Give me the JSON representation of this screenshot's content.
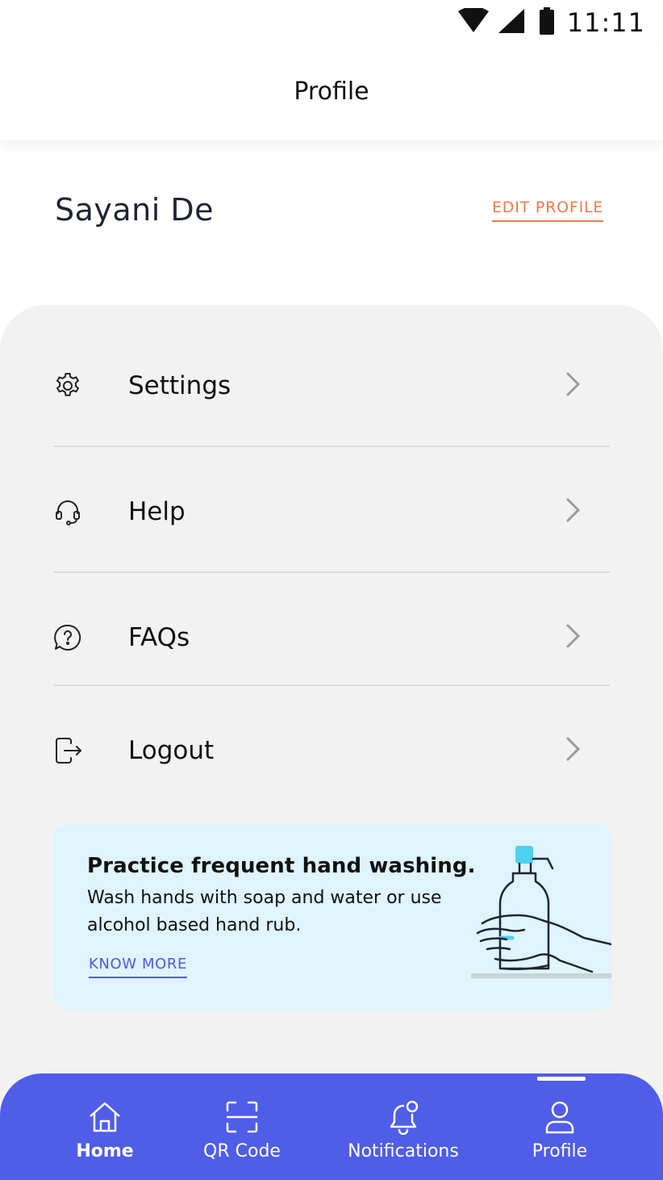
{
  "status_bar": {
    "time": "11:11",
    "icons": [
      "wifi-icon",
      "signal-icon",
      "battery-icon"
    ]
  },
  "header": {
    "title": "Profile"
  },
  "profile": {
    "name": "Sayani De",
    "edit_label": "EDIT PROFILE"
  },
  "menu": {
    "items": [
      {
        "label": "Settings",
        "icon": "gear-icon"
      },
      {
        "label": "Help",
        "icon": "headset-icon"
      },
      {
        "label": "FAQs",
        "icon": "question-bubble-icon"
      },
      {
        "label": "Logout",
        "icon": "logout-icon"
      }
    ]
  },
  "info_card": {
    "title": "Practice frequent hand washing.",
    "body": "Wash hands with soap and water or use alcohol based hand rub.",
    "link": "KNOW MORE",
    "illustration": "hand-sanitizer-illustration"
  },
  "bottom_nav": {
    "items": [
      {
        "label": "Home",
        "icon": "home-icon",
        "active": false
      },
      {
        "label": "QR Code",
        "icon": "qr-scan-icon",
        "active": false
      },
      {
        "label": "Notifications",
        "icon": "bell-icon",
        "active": false
      },
      {
        "label": "Profile",
        "icon": "user-icon",
        "active": true
      }
    ]
  },
  "colors": {
    "accent": "#f07a4c",
    "primary": "#4f5de9",
    "link": "#5058e6",
    "panel_bg": "#f2f2f2",
    "card_bg": "#dff4fb"
  }
}
